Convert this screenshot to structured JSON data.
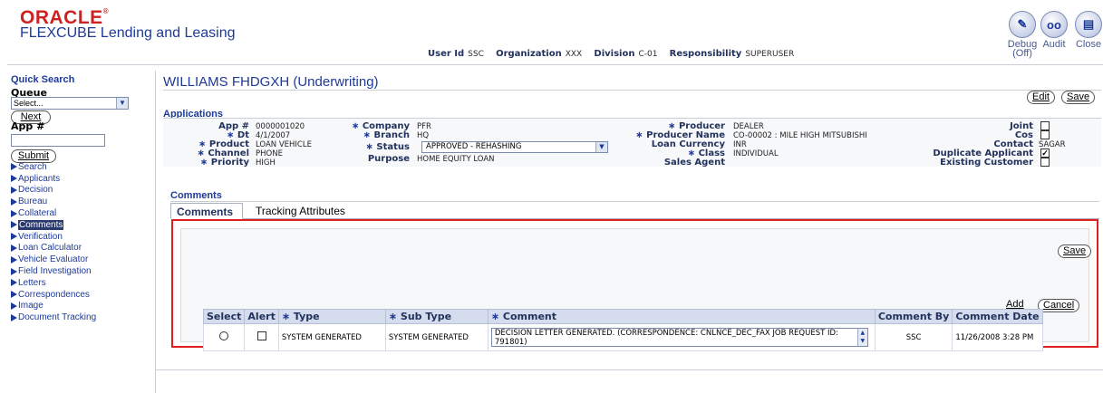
{
  "header": {
    "logo_oracle": "ORACLE",
    "logo_product": "FLEXCUBE Lending and Leasing",
    "user_id_label": "User Id",
    "user_id": "SSC",
    "org_label": "Organization",
    "org": "XXX",
    "division_label": "Division",
    "division": "C-01",
    "responsibility_label": "Responsibility",
    "responsibility": "SUPERUSER",
    "debug_label": "Debug",
    "debug_state": "(Off)",
    "audit_label": "Audit",
    "close_label": "Close"
  },
  "sidebar": {
    "quick_search": "Quick Search",
    "queue_label": "Queue",
    "queue_value": "Select...",
    "next_label": "Next",
    "app_label": "App #",
    "submit_label": "Submit",
    "items": [
      {
        "label": "Search"
      },
      {
        "label": "Applicants"
      },
      {
        "label": "Decision"
      },
      {
        "label": "Bureau"
      },
      {
        "label": "Collateral"
      },
      {
        "label": "Comments"
      },
      {
        "label": "Verification"
      },
      {
        "label": "Loan Calculator"
      },
      {
        "label": "Vehicle Evaluator"
      },
      {
        "label": "Field Investigation"
      },
      {
        "label": "Letters"
      },
      {
        "label": "Correspondences"
      },
      {
        "label": "Image"
      },
      {
        "label": "Document Tracking"
      }
    ]
  },
  "main": {
    "title": "WILLIAMS FHDGXH (Underwriting)",
    "edit_label": "Edit",
    "save_label": "Save",
    "applications_label": "Applications",
    "fields": {
      "app_label": "App #",
      "app": "0000001020",
      "dt_label": "Dt",
      "dt": "4/1/2007",
      "product_label": "Product",
      "product": "LOAN VEHICLE",
      "channel_label": "Channel",
      "channel": "PHONE",
      "priority_label": "Priority",
      "priority": "HIGH",
      "company_label": "Company",
      "company": "PFR",
      "branch_label": "Branch",
      "branch": "HQ",
      "status_label": "Status",
      "status": "APPROVED - REHASHING",
      "purpose_label": "Purpose",
      "purpose": "HOME EQUITY LOAN",
      "producer_label": "Producer",
      "producer": "DEALER",
      "producer_name_label": "Producer Name",
      "producer_name": "CO-00002 : MILE HIGH MITSUBISHI",
      "loan_currency_label": "Loan Currency",
      "loan_currency": "INR",
      "class_label": "Class",
      "class": "INDIVIDUAL",
      "sales_agent_label": "Sales Agent",
      "joint_label": "Joint",
      "cos_label": "Cos",
      "contact_label": "Contact",
      "contact": "SAGAR",
      "duplicate_label": "Duplicate Applicant",
      "existing_label": "Existing Customer"
    },
    "comments_section": "Comments",
    "tabs": [
      {
        "label": "Comments"
      },
      {
        "label": "Tracking Attributes"
      }
    ],
    "panel_save_label": "Save",
    "add_label": "Add",
    "cancel_label": "Cancel",
    "table": {
      "headers": {
        "select": "Select",
        "alert": "Alert",
        "type": "Type",
        "sub_type": "Sub Type",
        "comment": "Comment",
        "comment_by": "Comment By",
        "comment_date": "Comment Date"
      },
      "rows": [
        {
          "type": "SYSTEM GENERATED",
          "sub_type": "SYSTEM GENERATED",
          "comment": "DECISION LETTER  GENERATED. (CORRESPONDENCE: CNLNCE_DEC_FAX JOB REQUEST ID: 791801)",
          "comment_by": "SSC",
          "comment_date": "11/26/2008 3:28 PM"
        }
      ]
    }
  }
}
